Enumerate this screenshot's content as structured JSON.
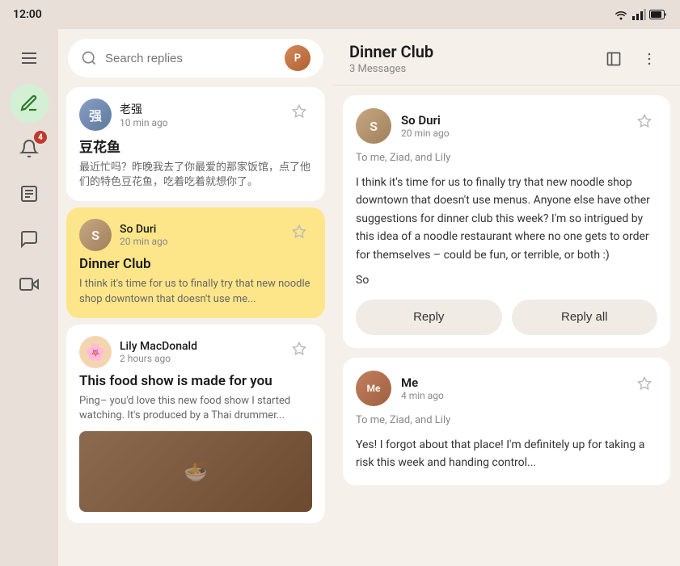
{
  "statusBar": {
    "time": "12:00"
  },
  "sidebar": {
    "items": [
      {
        "name": "hamburger-menu",
        "icon": "☰",
        "active": false,
        "badge": null
      },
      {
        "name": "compose",
        "icon": "✏️",
        "active": true,
        "badge": null
      },
      {
        "name": "notifications",
        "icon": "🔔",
        "active": false,
        "badge": "4"
      },
      {
        "name": "notes",
        "icon": "📋",
        "active": false,
        "badge": null
      },
      {
        "name": "chat",
        "icon": "💬",
        "active": false,
        "badge": null
      },
      {
        "name": "video",
        "icon": "🎥",
        "active": false,
        "badge": null
      }
    ]
  },
  "emailList": {
    "searchPlaceholder": "Search replies",
    "emails": [
      {
        "id": "email-1",
        "sender": "老强",
        "time": "10 min ago",
        "subject": "豆花鱼",
        "preview": "最近忙吗？昨晚我去了你最爱的那家饭馆，点了他们的特色豆花鱼，吃着吃着就想你了。",
        "selected": false,
        "avatarColor": "avatar-circle-1"
      },
      {
        "id": "email-2",
        "sender": "So Duri",
        "time": "20 min ago",
        "subject": "Dinner Club",
        "preview": "I think it's time for us to finally try that new noodle shop downtown that doesn't use me...",
        "selected": true,
        "avatarColor": "avatar-circle-2"
      },
      {
        "id": "email-3",
        "sender": "Lily MacDonald",
        "time": "2 hours ago",
        "subject": "This food show is made for you",
        "preview": "Ping– you'd love this new food show I started watching. It's produced by a Thai drummer...",
        "selected": false,
        "hasImage": true,
        "avatarColor": "flower-avatar"
      }
    ]
  },
  "detailPanel": {
    "title": "Dinner Club",
    "messageCount": "3 Messages",
    "messages": [
      {
        "id": "msg-1",
        "sender": "So Duri",
        "time": "20 min ago",
        "to": "To me, Ziad, and Lily",
        "body": "I think it's time for us to finally try that new noodle shop downtown that doesn't use menus. Anyone else have other suggestions for dinner club this week? I'm so intrigued by this idea of a noodle restaurant where no one gets to order for themselves – could be fun, or terrible, or both :)",
        "signature": "So",
        "avatarColor": "avatar-circle-2",
        "showReply": true
      },
      {
        "id": "msg-2",
        "sender": "Me",
        "time": "4 min ago",
        "to": "To me, Ziad, and Lily",
        "body": "Yes! I forgot about that place! I'm definitely up for taking a risk this week and handing control...",
        "avatarColor": "avatar-circle-me",
        "showReply": false
      }
    ],
    "replyLabel": "Reply",
    "replyAllLabel": "Reply all"
  }
}
